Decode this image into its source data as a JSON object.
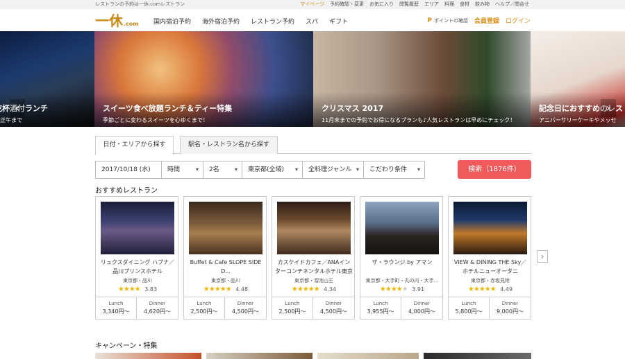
{
  "topbar": {
    "tagline": "レストランの予約は一休.comレストラン",
    "links": [
      {
        "label": "マイページ",
        "highlight": true
      },
      {
        "label": "予約確認・変更",
        "highlight": false
      },
      {
        "label": "お気に入り",
        "highlight": false
      },
      {
        "label": "閲覧履歴",
        "highlight": false
      },
      {
        "label": "エリア",
        "highlight": false
      },
      {
        "label": "料理",
        "highlight": false
      },
      {
        "label": "食材",
        "highlight": false
      },
      {
        "label": "飲み物",
        "highlight": false
      },
      {
        "label": "ヘルプ／問合せ",
        "highlight": false
      }
    ]
  },
  "header": {
    "logo_mark": "一休",
    "logo_suffix": ".com",
    "nav": [
      "国内宿泊予約",
      "海外宿泊予約",
      "レストラン予約",
      "スパ",
      "ギフト"
    ],
    "points_icon": "P",
    "points_label": "ポイントの確認",
    "member_label": "会員登録",
    "login_label": "ログイン",
    "accent_color": "#d9901a"
  },
  "hero": {
    "slides": [
      {
        "title": "乾杯酒付ランチ",
        "subtitle": "）正午まで"
      },
      {
        "title": "スイーツ食べ放題ランチ＆ティー特集",
        "subtitle": "季節ごとに変わるスイーツを心ゆくまで！"
      },
      {
        "title": "クリスマス 2017",
        "subtitle": "11月末までの予約でお得になるプランも♪人気レストランは早めにチェック！"
      },
      {
        "title": "記念日におすすめのレスト",
        "subtitle": "アニバーサリーケーキやメッセ"
      }
    ],
    "prev_icon": "‹",
    "next_icon": "›"
  },
  "tabs": [
    {
      "label": "日付・エリアから探す",
      "active": true
    },
    {
      "label": "駅名・レストラン名から探す",
      "active": false
    }
  ],
  "search": {
    "date": "2017/10/18 (水)",
    "time": "時間",
    "people": "2名",
    "area": "東京都(全域)",
    "genre": "全料理ジャンル",
    "conditions": "こだわり条件",
    "caret": "▾",
    "button_label": "検索（1876件）",
    "button_color": "#f05a5a"
  },
  "recommended": {
    "title": "おすすめレストラン",
    "next_icon": "›",
    "lunch_label": "Lunch",
    "dinner_label": "Dinner",
    "items": [
      {
        "name": "リュクスダイニング ハプナ／品川プリンスホテル",
        "area": "東京都・品川",
        "rating": 3.83,
        "stars": "★★★★",
        "stars_off": "",
        "lunch": "3,340円〜",
        "dinner": "4,620円〜"
      },
      {
        "name": "Buffet & Cafe SLOPE SIDE D...",
        "area": "東京都・品川",
        "rating": 4.48,
        "stars": "★★★★★",
        "stars_off": "",
        "lunch": "2,500円〜",
        "dinner": "4,500円〜"
      },
      {
        "name": "カスケイドカフェ／ANAインターコンチネンタルホテル東京",
        "area": "東京都・溜池山王",
        "rating": 4.34,
        "stars": "★★★★★",
        "stars_off": "",
        "lunch": "2,500円〜",
        "dinner": "4,500円〜"
      },
      {
        "name": "ザ・ラウンジ by アマン",
        "area": "東京都・大手町・丸の内・大手...",
        "rating": 3.91,
        "stars": "★★★★",
        "stars_off": "★",
        "lunch": "3,955円〜",
        "dinner": "4,000円〜"
      },
      {
        "name": "VIEW & DINING THE Sky／ホテルニューオータニ",
        "area": "東京都・赤坂見附",
        "rating": 4.49,
        "stars": "★★★★★",
        "stars_off": "",
        "lunch": "5,800円〜",
        "dinner": "9,000円〜"
      }
    ]
  },
  "campaign": {
    "title": "キャンペーン・特集"
  }
}
